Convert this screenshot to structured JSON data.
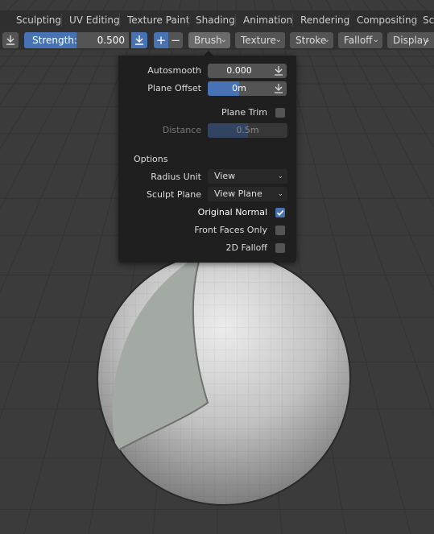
{
  "workspace_tabs": [
    "Sculpting",
    "UV Editing",
    "Texture Paint",
    "Shading",
    "Animation",
    "Rendering",
    "Compositing",
    "Scr"
  ],
  "toolbar": {
    "strength_label": "Strength:",
    "strength_value": "0.500",
    "strength_fraction": 0.5,
    "plus_label": "+",
    "minus_label": "−",
    "menus": [
      "Brush",
      "Texture",
      "Stroke",
      "Falloff",
      "Display"
    ]
  },
  "brush_panel": {
    "autosmooth": {
      "label": "Autosmooth",
      "value": "0.000",
      "fraction": 0.0
    },
    "plane_offset": {
      "label": "Plane Offset",
      "value": "0m",
      "fraction": 0.5
    },
    "plane_trim": {
      "label": "Plane Trim",
      "checked": false
    },
    "distance": {
      "label": "Distance",
      "value": "0.5m",
      "fraction": 0.5,
      "enabled": false
    },
    "options_heading": "Options",
    "radius_unit": {
      "label": "Radius Unit",
      "value": "View"
    },
    "sculpt_plane": {
      "label": "Sculpt Plane",
      "value": "View Plane"
    },
    "original_normal": {
      "label": "Original Normal",
      "checked": true
    },
    "front_faces_only": {
      "label": "Front Faces Only",
      "checked": false
    },
    "two_d_falloff": {
      "label": "2D Falloff",
      "checked": false
    }
  },
  "colors": {
    "accent": "#4772b3",
    "panel_bg": "#1f1f1f",
    "viewport_bg": "#393939",
    "sphere": "#bdbdbd"
  }
}
